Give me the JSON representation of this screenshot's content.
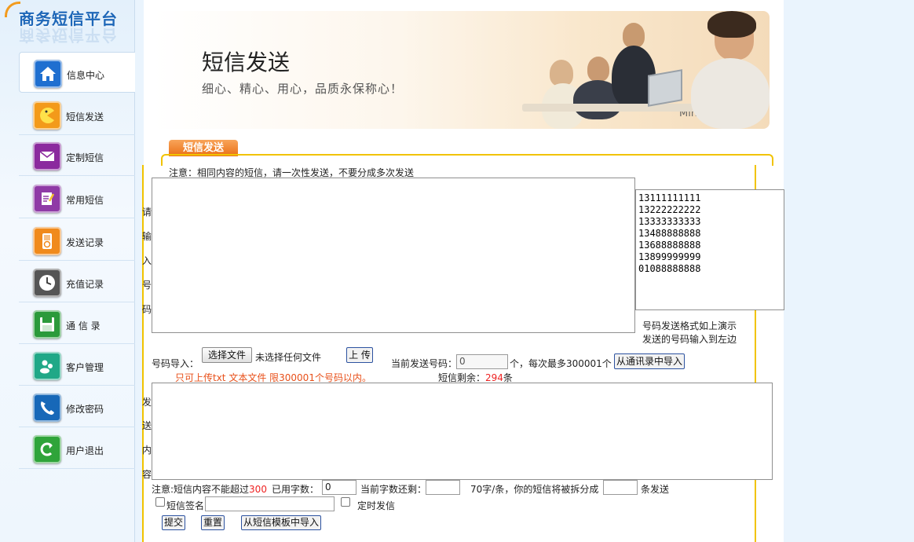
{
  "sidebar": {
    "logo": "商务短信平台",
    "items": [
      {
        "label": "信息中心",
        "icon": "home-icon",
        "color": "#1f6fd0"
      },
      {
        "label": "短信发送",
        "icon": "pacman-icon",
        "color": "#f39a1a"
      },
      {
        "label": "定制短信",
        "icon": "envelope-icon",
        "color": "#8b2a9e"
      },
      {
        "label": "常用短信",
        "icon": "notepad-icon",
        "color": "#8f3aa6"
      },
      {
        "label": "发送记录",
        "icon": "ipod-icon",
        "color": "#f08a1c"
      },
      {
        "label": "充值记录",
        "icon": "clock-icon",
        "color": "#555555"
      },
      {
        "label": "通 信 录",
        "icon": "floppy-icon",
        "color": "#2b9a3b"
      },
      {
        "label": "客户管理",
        "icon": "users-icon",
        "color": "#20a887"
      },
      {
        "label": "修改密码",
        "icon": "phone-icon",
        "color": "#1768b8"
      },
      {
        "label": "用户退出",
        "icon": "exit-icon",
        "color": "#2fa43a"
      }
    ]
  },
  "banner": {
    "title": "短信发送",
    "subtitle": "细心、精心、用心，品质永保称心！",
    "version": "Mingnet 2.0"
  },
  "tab": {
    "label": "短信发送"
  },
  "form": {
    "notice": "注意：相同内容的短信，请一次性发送，不要分成多次发送",
    "numbers_label": [
      "请",
      "输",
      "入",
      "号",
      "码"
    ],
    "numbers_value": "",
    "example_numbers": "13111111111\n13222222222\n13333333333\n13488888888\n13688888888\n13899999999\n01088888888",
    "example_hint_line1": "号码发送格式如上演示",
    "example_hint_line2": "发送的号码输入到左边",
    "import_label": "号码导入：",
    "choose_file_button": "选择文件",
    "no_file_text": "未选择任何文件",
    "upload_button": "上 传",
    "upload_hint": "只可上传txt 文本文件  限300001个号码以内。",
    "current_numbers_label": "当前发送号码：",
    "current_numbers_value": "0",
    "max_numbers_text": "个，每次最多300001个",
    "import_contacts_button": "从通讯录中导入",
    "remaining_prefix": "短信剩余：",
    "remaining_count": "294",
    "remaining_suffix": "条",
    "content_label": [
      "发",
      "送",
      "内",
      "容"
    ],
    "content_value": "",
    "limit_prefix": "注意:短信内容不能超过",
    "limit_value": "300",
    "used_label": "已用字数：",
    "used_value": "0",
    "left_label": "当前字数还剩：",
    "left_value": "",
    "split_text": "70字/条，你的短信将被拆分成",
    "split_value": "",
    "split_suffix": "条发送",
    "signature_label": "短信签名",
    "signature_value": "",
    "schedule_label": "定时发信",
    "submit_button": "提交",
    "reset_button": "重置",
    "template_button": "从短信模板中导入"
  }
}
